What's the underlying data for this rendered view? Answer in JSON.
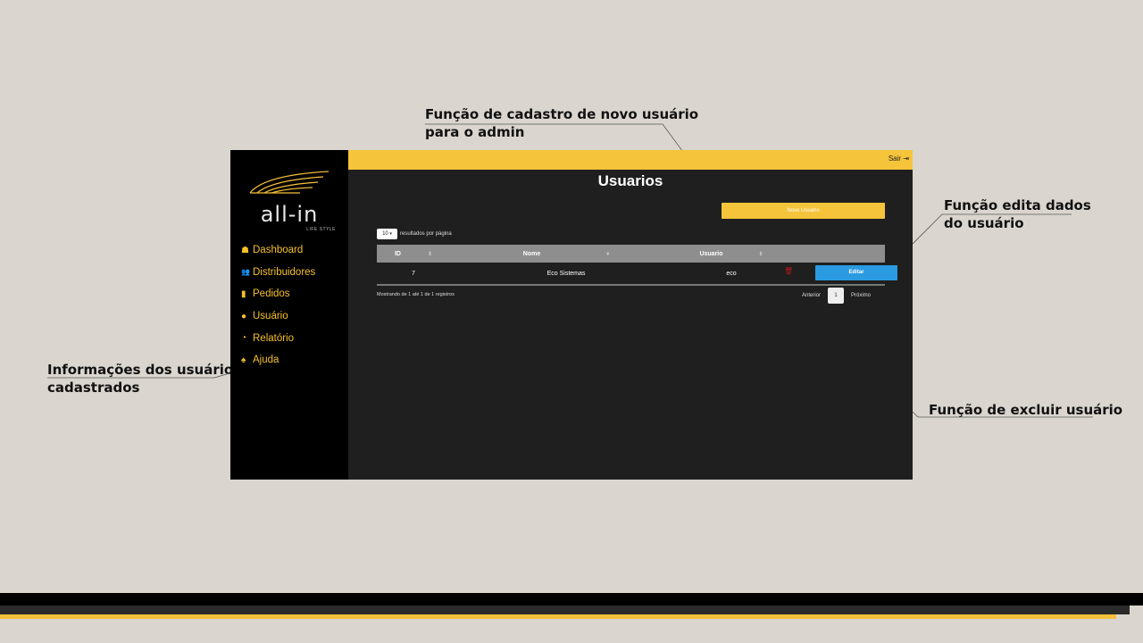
{
  "annotations": {
    "new_user": "Função de cadastro de novo usuário\npara o admin",
    "edit_user": "Função edita dados\ndo usuário",
    "user_info": "Informações dos usuários\ncadastrados",
    "delete_user": "Função de excluir usuário"
  },
  "sidebar": {
    "logo_text": "all-in",
    "logo_sub": "LIFE STYLE",
    "items": [
      {
        "label": "Dashboard",
        "icon": "home-icon",
        "glyph": "☗"
      },
      {
        "label": "Distribuidores",
        "icon": "users-icon",
        "glyph": "👥"
      },
      {
        "label": "Pedidos",
        "icon": "file-icon",
        "glyph": "▮"
      },
      {
        "label": "Usuário",
        "icon": "user-icon",
        "glyph": "●"
      },
      {
        "label": "Relatório",
        "icon": "pie-chart-icon",
        "glyph": "◔"
      },
      {
        "label": "Ajuda",
        "icon": "bell-icon",
        "glyph": "♠"
      }
    ]
  },
  "header": {
    "logout_label": "Sair"
  },
  "main": {
    "title": "Usuarios",
    "new_button": "Novo Usuario",
    "length_value": "10",
    "length_label": "resultados por página",
    "columns": [
      "ID",
      "Nome",
      "Usuario"
    ],
    "rows": [
      {
        "id": "7",
        "nome": "Eco Sistemas",
        "usuario": "eco",
        "edit_label": "Editar"
      }
    ],
    "info": "Mostrando de 1 até 1 de 1 registros",
    "pager": {
      "prev": "Anterior",
      "current": "1",
      "next": "Próximo"
    }
  },
  "colors": {
    "accent": "#f6c43a",
    "edit": "#2a9be0",
    "delete": "#b51a1a",
    "background": "#dad6cf"
  }
}
